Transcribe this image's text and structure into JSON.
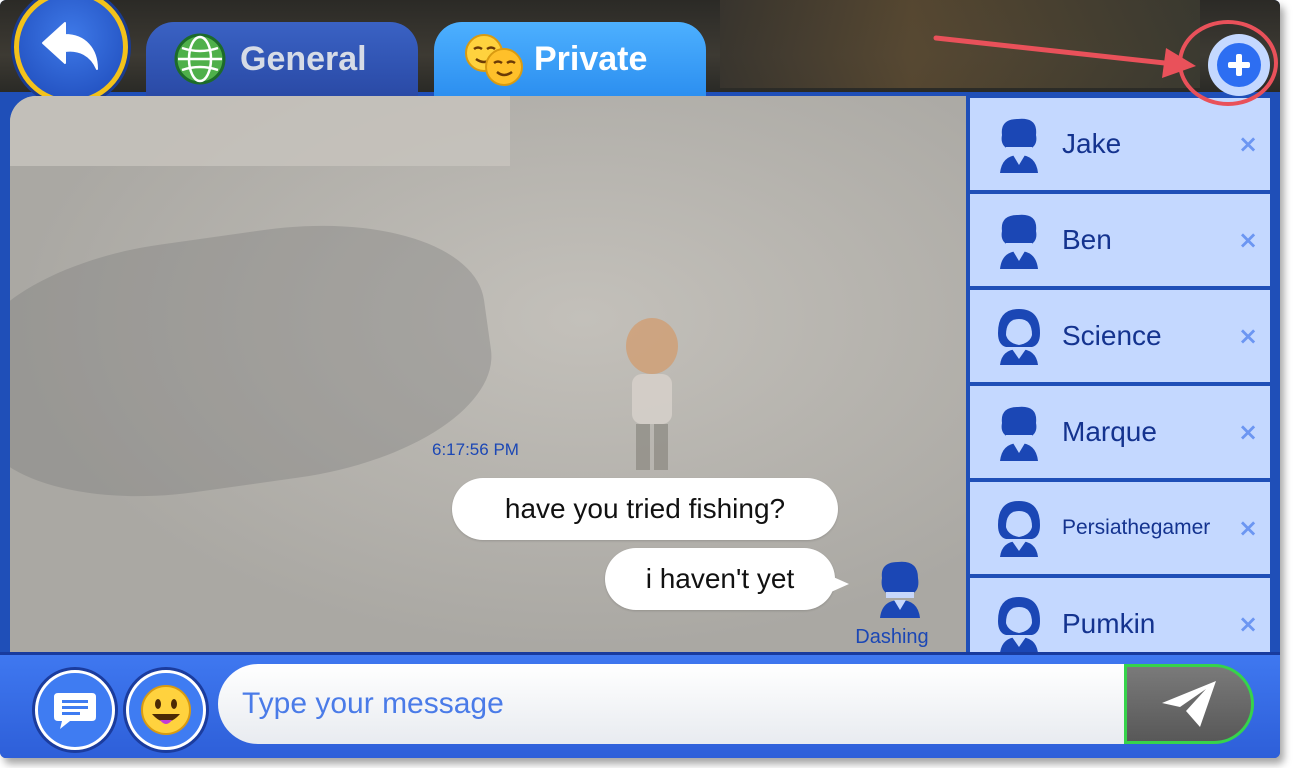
{
  "header": {
    "back_icon": "back-arrow-icon",
    "tabs": [
      {
        "label": "General",
        "icon": "globe-icon",
        "active": false
      },
      {
        "label": "Private",
        "icon": "faces-icon",
        "active": true
      }
    ],
    "add_icon": "plus-icon"
  },
  "chat": {
    "timestamp": "6:17:56 PM",
    "messages": [
      {
        "text": "have you tried fishing?"
      },
      {
        "text": "i haven't yet",
        "sender": "Dashing"
      }
    ]
  },
  "contacts": [
    {
      "name": "Jake",
      "avatar": "boy-avatar-icon"
    },
    {
      "name": "Ben",
      "avatar": "boy-avatar-icon"
    },
    {
      "name": "Science",
      "avatar": "girl-avatar-icon"
    },
    {
      "name": "Marque",
      "avatar": "boy-avatar-icon"
    },
    {
      "name": "Persiathegamer",
      "avatar": "girl-avatar-icon"
    },
    {
      "name": "Pumkin",
      "avatar": "girl-avatar-icon"
    }
  ],
  "contact_close_glyph": "×",
  "composer": {
    "placeholder": "Type your message",
    "chat_bubble_icon": "chat-bubble-icon",
    "emoji_icon": "emoji-icon",
    "send_icon": "send-icon"
  },
  "colors": {
    "primary_blue": "#1f4fb8",
    "tab_active": "#2c8ff0",
    "contact_bg": "#c4d8ff",
    "highlight": "#e9515a",
    "send_border": "#36d34b"
  }
}
